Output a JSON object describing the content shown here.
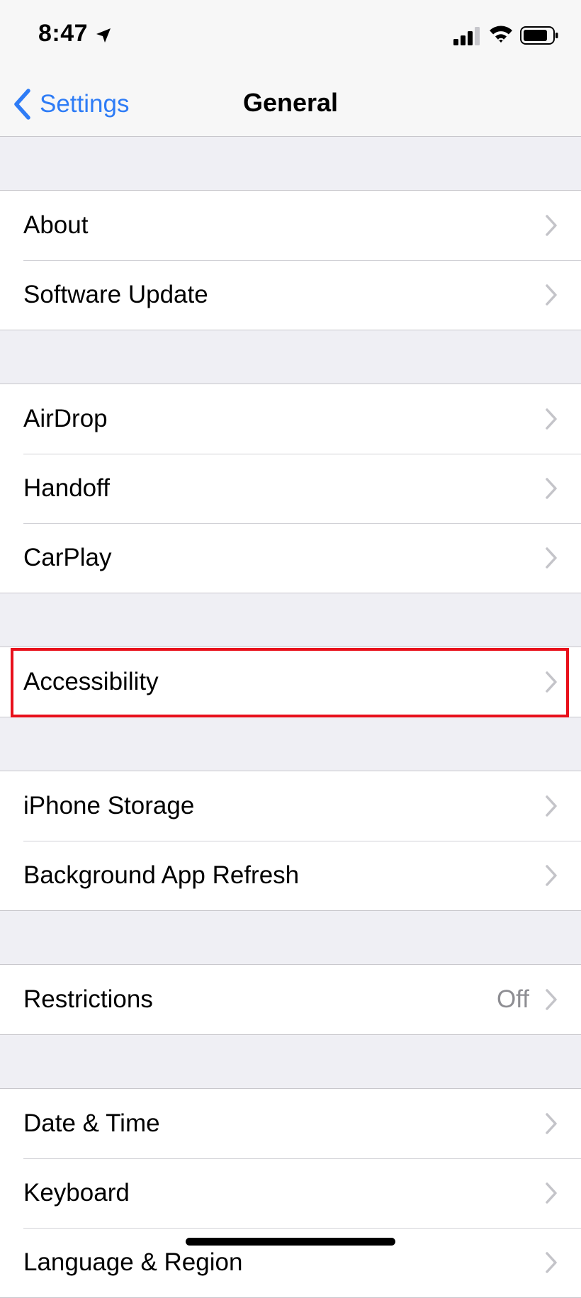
{
  "status_bar": {
    "time": "8:47",
    "icons": [
      "location-arrow-icon",
      "signal-icon",
      "wifi-icon",
      "battery-icon"
    ]
  },
  "nav": {
    "back_label": "Settings",
    "title": "General"
  },
  "groups": [
    {
      "rows": [
        {
          "label": "About"
        },
        {
          "label": "Software Update"
        }
      ]
    },
    {
      "rows": [
        {
          "label": "AirDrop"
        },
        {
          "label": "Handoff"
        },
        {
          "label": "CarPlay"
        }
      ]
    },
    {
      "rows": [
        {
          "label": "Accessibility"
        }
      ]
    },
    {
      "rows": [
        {
          "label": "iPhone Storage"
        },
        {
          "label": "Background App Refresh"
        }
      ]
    },
    {
      "rows": [
        {
          "label": "Restrictions",
          "value": "Off"
        }
      ]
    },
    {
      "rows": [
        {
          "label": "Date & Time"
        },
        {
          "label": "Keyboard"
        },
        {
          "label": "Language & Region"
        }
      ]
    }
  ],
  "colors": {
    "accent": "#2e7cf6",
    "highlight": "#e8101b",
    "background": "#efeff4"
  }
}
